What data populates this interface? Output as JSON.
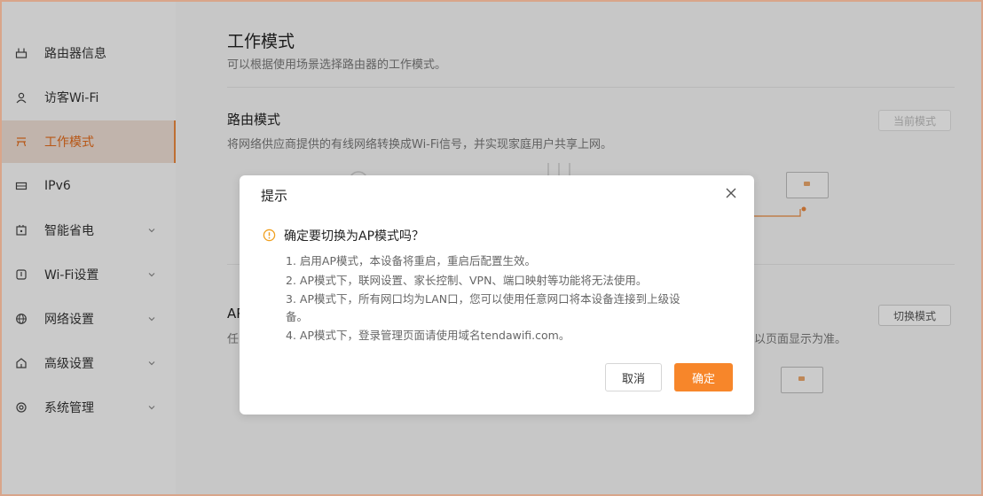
{
  "sidebar": {
    "items": [
      {
        "label": "路由器信息"
      },
      {
        "label": "访客Wi-Fi"
      },
      {
        "label": "工作模式"
      },
      {
        "label": "IPv6"
      },
      {
        "label": "智能省电"
      },
      {
        "label": "Wi-Fi设置"
      },
      {
        "label": "网络设置"
      },
      {
        "label": "高级设置"
      },
      {
        "label": "系统管理"
      }
    ],
    "active_index": 2
  },
  "main": {
    "title": "工作模式",
    "subtitle": "可以根据使用场景选择路由器的工作模式。",
    "router_mode": {
      "title": "路由模式",
      "desc": "将网络供应商提供的有线网络转换成Wi-Fi信号，并实现家庭用户共享上网。",
      "button": "当前模式"
    },
    "ap_mode": {
      "title_fragment": "AP",
      "desc_fragment": "任",
      "desc_tail": "以页面显示为准。",
      "button": "切换模式"
    }
  },
  "dialog": {
    "title": "提示",
    "question": "确定要切换为AP模式吗？",
    "lines": [
      "1. 启用AP模式，本设备将重启，重启后配置生效。",
      "2. AP模式下，联网设置、家长控制、VPN、端口映射等功能将无法使用。",
      "3. AP模式下，所有网口均为LAN口，您可以使用任意网口将本设备连接到上级设",
      "备。",
      "4. AP模式下，登录管理页面请使用域名tendawifi.com。"
    ],
    "cancel_label": "取消",
    "ok_label": "确定"
  },
  "colors": {
    "accent": "#f7862a",
    "active_text": "#e06a1a",
    "warning_icon": "#f0a020"
  }
}
